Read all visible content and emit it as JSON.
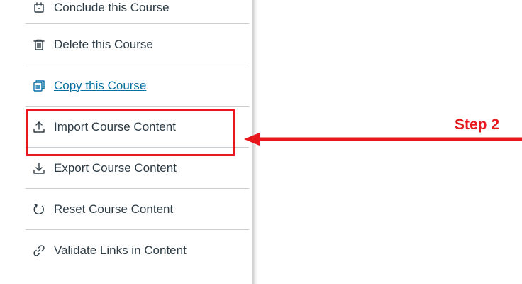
{
  "menu": {
    "items": [
      {
        "label": "Conclude this Course",
        "icon": "conclude-icon"
      },
      {
        "label": "Delete this Course",
        "icon": "trash-icon"
      },
      {
        "label": "Copy this Course",
        "icon": "copy-icon"
      },
      {
        "label": "Import Course Content",
        "icon": "upload-icon"
      },
      {
        "label": "Export Course Content",
        "icon": "download-icon"
      },
      {
        "label": "Reset Course Content",
        "icon": "reset-icon"
      },
      {
        "label": "Validate Links in Content",
        "icon": "link-icon"
      }
    ]
  },
  "annotation": {
    "step_label": "Step 2",
    "color": "#e8171b"
  },
  "colors": {
    "text": "#2d3b45",
    "link": "#0770a3",
    "divider": "#c7cdd1"
  }
}
